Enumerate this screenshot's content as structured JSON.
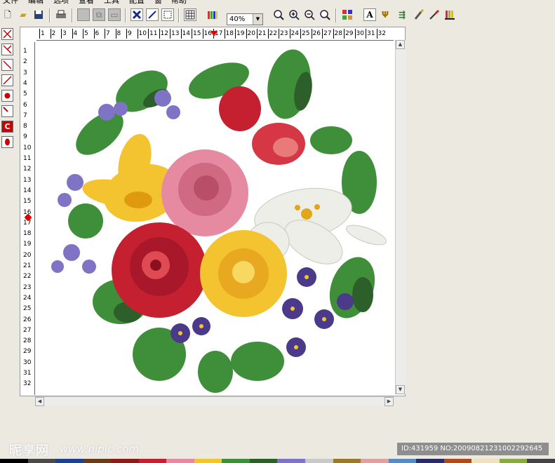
{
  "menu": {
    "items": [
      "文件",
      "编辑",
      "选项",
      "查看",
      "工具",
      "配置",
      "窗",
      "帮助"
    ]
  },
  "toolbar": {
    "zoom_value": "40%",
    "zoom_arrow": "▼"
  },
  "rulers": {
    "horizontal": [
      "1",
      "2",
      "3",
      "4",
      "5",
      "6",
      "7",
      "8",
      "9",
      "10",
      "11",
      "12",
      "13",
      "14",
      "15",
      "16",
      "17",
      "18",
      "19",
      "20",
      "21",
      "22",
      "23",
      "24",
      "25",
      "26",
      "27",
      "28",
      "29",
      "30",
      "31",
      "32"
    ],
    "vertical": [
      "1",
      "2",
      "3",
      "4",
      "5",
      "6",
      "7",
      "8",
      "9",
      "10",
      "11",
      "12",
      "13",
      "14",
      "15",
      "16",
      "17",
      "18",
      "19",
      "20",
      "21",
      "22",
      "23",
      "24",
      "25",
      "26",
      "27",
      "28",
      "29",
      "30",
      "31",
      "32"
    ]
  },
  "footer": {
    "watermark": "昵享网",
    "watermark_url": "www.nipic.com",
    "image_id": "ID:431959 NO:20090821231002292645"
  },
  "colors": {
    "rose_red": "#c42030",
    "rose_pink": "#e58aa0",
    "yellow": "#f4c430",
    "white_lily": "#f4f4f0",
    "leaf": "#3f8f3a",
    "violet": "#7f73c5",
    "accent_red": "#d00000"
  },
  "palette": [
    "#000000",
    "#4a4a4a",
    "#1f3f8f",
    "#6a3a1a",
    "#8a1c1c",
    "#c42030",
    "#e58aa0",
    "#f4c430",
    "#3f8f3a",
    "#2d5f2a",
    "#7f73c5",
    "#c9c9c9",
    "#9a7a2a",
    "#e0a0a0",
    "#5a8ac4",
    "#2a2a6a",
    "#b04a1a",
    "#f0e0c0",
    "#88aa44",
    "#444444"
  ]
}
